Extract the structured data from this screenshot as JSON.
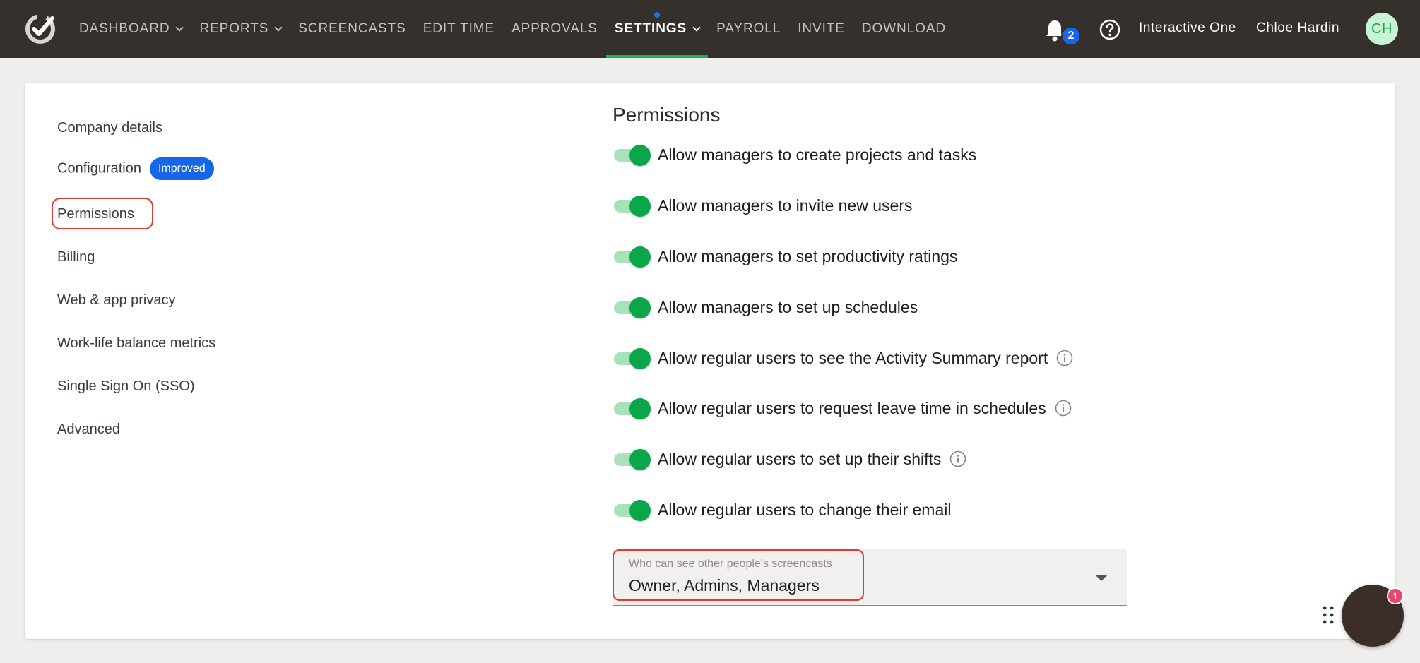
{
  "nav": {
    "items": [
      {
        "label": "DASHBOARD",
        "has_caret": true
      },
      {
        "label": "REPORTS",
        "has_caret": true
      },
      {
        "label": "SCREENCASTS",
        "has_caret": false
      },
      {
        "label": "EDIT TIME",
        "has_caret": false
      },
      {
        "label": "APPROVALS",
        "has_caret": false
      },
      {
        "label": "SETTINGS",
        "has_caret": true,
        "active": true
      },
      {
        "label": "PAYROLL",
        "has_caret": false
      },
      {
        "label": "INVITE",
        "has_caret": false
      },
      {
        "label": "DOWNLOAD",
        "has_caret": false
      }
    ]
  },
  "header": {
    "notifications_count": "2",
    "company": "Interactive One",
    "user_name": "Chloe Hardin",
    "avatar_initials": "CH"
  },
  "sidebar": {
    "items": [
      {
        "label": "Company details"
      },
      {
        "label": "Configuration",
        "badge": "Improved"
      },
      {
        "label": "Permissions",
        "selected": true
      },
      {
        "label": "Billing"
      },
      {
        "label": "Web & app privacy"
      },
      {
        "label": "Work-life balance metrics"
      },
      {
        "label": "Single Sign On (SSO)"
      },
      {
        "label": "Advanced"
      }
    ]
  },
  "main": {
    "title": "Permissions",
    "permissions": [
      {
        "label": "Allow managers to create projects and tasks",
        "enabled": true,
        "info": false
      },
      {
        "label": "Allow managers to invite new users",
        "enabled": true,
        "info": false
      },
      {
        "label": "Allow managers to set productivity ratings",
        "enabled": true,
        "info": false
      },
      {
        "label": "Allow managers to set up schedules",
        "enabled": true,
        "info": false
      },
      {
        "label": "Allow regular users to see the Activity Summary report",
        "enabled": true,
        "info": true
      },
      {
        "label": "Allow regular users to request leave time in schedules",
        "enabled": true,
        "info": true
      },
      {
        "label": "Allow regular users to set up their shifts",
        "enabled": true,
        "info": true
      },
      {
        "label": "Allow regular users to change their email",
        "enabled": true,
        "info": false
      }
    ],
    "screencasts_select": {
      "label": "Who can see other people's screencasts",
      "value": "Owner, Admins, Managers"
    }
  },
  "chat": {
    "unread_count": "1"
  },
  "colors": {
    "topbar": "#35302c",
    "accent_green": "#16b44d",
    "accent_blue": "#1566e8",
    "highlight_red": "#e23a2e"
  }
}
